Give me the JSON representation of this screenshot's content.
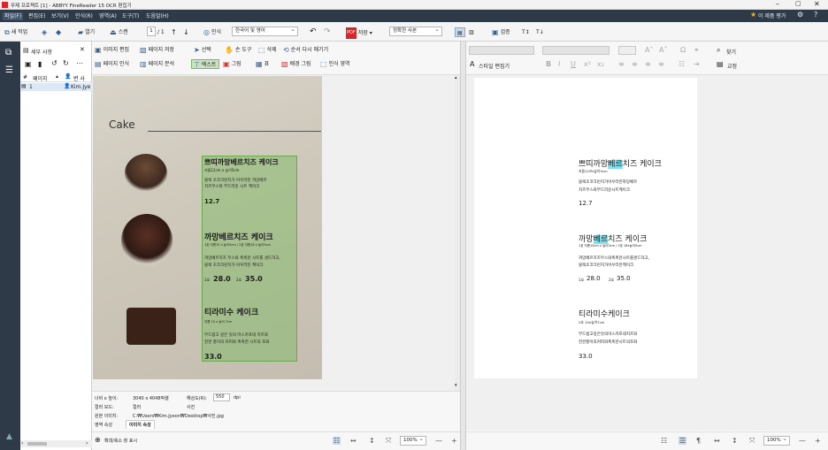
{
  "window": {
    "title": "무제 프로젝트 [1] - ABBYY FineReader 15 OCR 편집기"
  },
  "menu": [
    "파일(F)",
    "편집(E)",
    "보기(V)",
    "인식(R)",
    "영역(A)",
    "도구(T)",
    "도움말(H)"
  ],
  "menu_right": {
    "rate_label": "이 제품 평가"
  },
  "toolbar": {
    "new_task": "새 작업",
    "open": "열기",
    "scan": "스캔",
    "page_indicator": "1",
    "page_total": "/ 1",
    "recognize": "인식",
    "language": "한국어 및 영어",
    "save": "저장",
    "save_mode": "정확한 사본",
    "verify": "검증"
  },
  "sidebar": {
    "title": "세부 사항",
    "col_page": "페이지",
    "col_author": "변 사",
    "row_num": "1",
    "row_author": "Kim.Jye"
  },
  "image_tools": {
    "edit_image": "이미지 편집",
    "page_save": "페이지 저장",
    "page_recognize": "페이지 인식",
    "page_analyze": "페이지 분석",
    "select": "선택",
    "hand": "손 도구",
    "delete": "삭제",
    "reorder": "순서 다시 매기기",
    "text": "텍스트",
    "picture": "그림",
    "table": "표",
    "bg_picture": "배경 그림",
    "recognition_area": "인식 영역"
  },
  "photo": {
    "heading": "Cake",
    "item1_name": "쁘띠까망베르치즈 케이크",
    "item1_size": "지름12cm x 높이5cm",
    "item1_desc1": "블랙 초코크런치가 어우러진 까망베르",
    "item1_desc2": "치즈무스와 부드러운 시트 케이크",
    "item1_price": "12.7",
    "item2_name": "까망베르치즈 케이크",
    "item2_size": "1호 지름15 x 높이5cm / 2호 지름18 x 높이5cm",
    "item2_desc1": "까망베르치즈 무스와 촉촉한 시트를 샌드하고,",
    "item2_desc2": "블랙 초코크런치가 어우러진 케이크",
    "item2_size1": "1호",
    "item2_price1": "28.0",
    "item2_size2": "2호",
    "item2_price2": "35.0",
    "item3_name": "티라미수 케이크",
    "item3_size": "지름 10 x 높이 7cm",
    "item3_desc1": "부드럽고 깊은 맛의 마스카포네 치즈와",
    "item3_desc2": "진한 풍미의 커피와 촉촉한 시트의 조화",
    "item3_price": "33.0"
  },
  "image_info": {
    "size_label": "너비 x 높이:",
    "size_value": "3040 x 4048픽셀",
    "res_label": "해상도(R):",
    "res_value": "550",
    "res_unit": "dpi",
    "color_label": "컬러 모드:",
    "color_value": "컬러",
    "type_value": "사진",
    "orig_label": "원본 이미지:",
    "orig_value": "C:₩Users₩Kim.Jyeon₩Desktop₩사진.jpg",
    "tab_area": "영역 속성",
    "tab_image": "이미지 속성"
  },
  "image_bottom": {
    "zoom_label": "확대/축소 창 표시",
    "zoom_value": "100%"
  },
  "text_tools": {
    "find": "찾기",
    "style_editor": "스타일 편집기",
    "correct": "교정"
  },
  "recognized": {
    "item1_name_a": "쁘띠까망",
    "item1_name_hl": "베르",
    "item1_name_b": "치즈 케이크",
    "item1_size": "지름12쓰x높이5cm",
    "item1_desc1": "블랙초코크런치가어우러진까망베르",
    "item1_desc2": "치즈무스와부드러운시트케이크",
    "item1_price": "12.7",
    "item2_name_a": "까망",
    "item2_name_hl": "베르",
    "item2_name_b": "치즈 케이크",
    "item2_size": "1호 지름15cm x 높이5cm / 2호 18x높이5cm",
    "item2_desc1": "까망베르치즈무스와촉촉한시트를샌드하고,",
    "item2_desc2": "블랙초코크런치가어우러진케이크",
    "item2_size1": "1호",
    "item2_price1": "28.0",
    "item2_size2": "2호",
    "item2_price2": "35.0",
    "item3_name": "티라미수케이크",
    "item3_size": "2호 10x높이7cm",
    "item3_desc1": "부드럽고깊은맛의마스카포네치즈와",
    "item3_desc2": "진한풍미의커피와촉촉한시트의조화",
    "item3_price": "33.0"
  },
  "text_bottom": {
    "zoom_value": "100%"
  },
  "colors": {
    "accent": "#2e3a48",
    "highlight": "#7fe0ef",
    "ocr_zone": "#78b95a"
  }
}
